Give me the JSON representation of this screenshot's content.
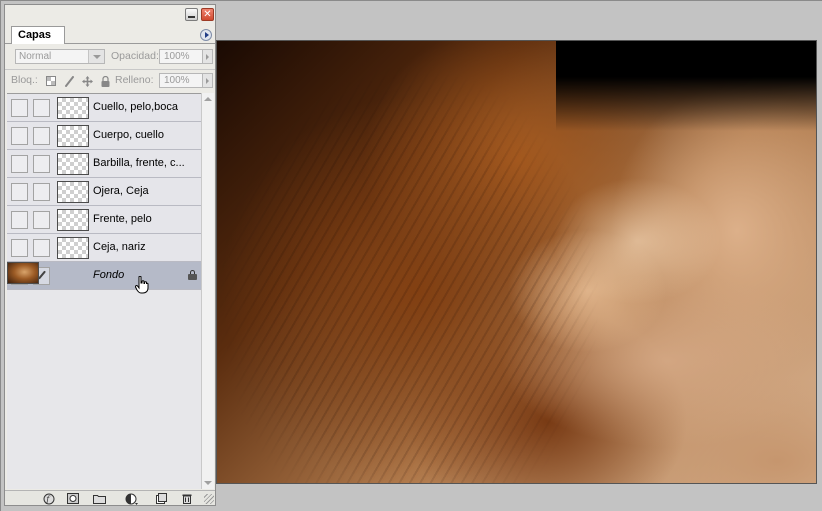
{
  "panel": {
    "tab_label": "Capas",
    "blend_mode": "Normal",
    "opacity_label": "Opacidad:",
    "opacity_value": "100%",
    "lock_label": "Bloq.:",
    "fill_label": "Relleno:",
    "fill_value": "100%"
  },
  "layers": [
    {
      "name": "Cuello, pelo,boca"
    },
    {
      "name": "Cuerpo, cuello"
    },
    {
      "name": "Barbilla, frente, c..."
    },
    {
      "name": "Ojera, Ceja"
    },
    {
      "name": "Frente, pelo"
    },
    {
      "name": "Ceja, nariz"
    },
    {
      "name": "Fondo",
      "selected": true,
      "visible": true,
      "locked": true
    }
  ],
  "bottom_tools": [
    "link-layers-icon",
    "layer-style-icon",
    "layer-mask-icon",
    "new-group-icon",
    "adjustment-layer-icon",
    "new-layer-icon",
    "delete-layer-icon"
  ],
  "colors": {
    "panel_bg": "#ecebe6",
    "selected_row": "#b5bac8",
    "close_button": "#d04a2f"
  }
}
